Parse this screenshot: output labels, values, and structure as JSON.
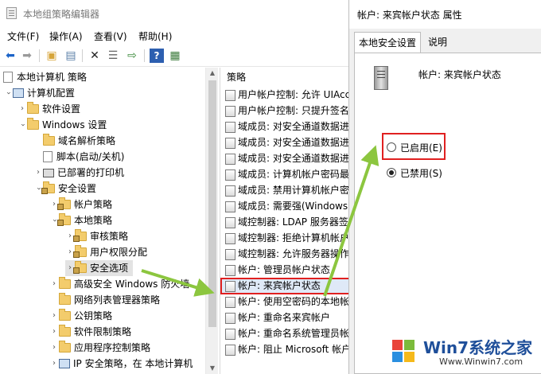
{
  "main_window": {
    "title": "本地组策略编辑器",
    "menu": [
      "文件(F)",
      "操作(A)",
      "查看(V)",
      "帮助(H)"
    ],
    "toolbar_icons": [
      "back-arrow-icon",
      "forward-arrow-icon",
      "up-folder-icon",
      "show-hide-tree-icon",
      "delete-icon",
      "properties-icon",
      "export-icon",
      "help-icon",
      "view-icon"
    ]
  },
  "tree": {
    "items": [
      {
        "label": "本地计算机 策略"
      },
      {
        "label": "计算机配置"
      },
      {
        "label": "软件设置"
      },
      {
        "label": "Windows 设置"
      },
      {
        "label": "域名解析策略"
      },
      {
        "label": "脚本(启动/关机)"
      },
      {
        "label": "已部署的打印机"
      },
      {
        "label": "安全设置"
      },
      {
        "label": "帐户策略"
      },
      {
        "label": "本地策略"
      },
      {
        "label": "审核策略"
      },
      {
        "label": "用户权限分配"
      },
      {
        "label": "安全选项"
      },
      {
        "label": "高级安全 Windows 防火墙"
      },
      {
        "label": "网络列表管理器策略"
      },
      {
        "label": "公钥策略"
      },
      {
        "label": "软件限制策略"
      },
      {
        "label": "应用程序控制策略"
      },
      {
        "label": "IP 安全策略，在 本地计算机"
      }
    ]
  },
  "policy_list": {
    "header": "策略",
    "items": [
      "用户帐户控制: 允许 UIAccess",
      "用户帐户控制: 只提升签名并",
      "域成员: 对安全通道数据进行",
      "域成员: 对安全通道数据进行",
      "域成员: 对安全通道数据进行",
      "域成员: 计算机帐户密码最",
      "域成员: 禁用计算机帐户密码",
      "域成员: 需要强(Windows",
      "域控制器: LDAP 服务器签名",
      "域控制器: 拒绝计算机帐户密",
      "域控制器: 允许服务器操作",
      "帐户: 管理员帐户状态",
      "帐户: 来宾帐户状态",
      "帐户: 使用空密码的本地帐",
      "帐户: 重命名来宾帐户",
      "帐户: 重命名系统管理员帐",
      "帐户: 阻止 Microsoft 帐户"
    ]
  },
  "dialog": {
    "title": "帐户: 来宾帐户状态 属性",
    "tabs": [
      "本地安全设置",
      "说明"
    ],
    "policy_name": "帐户: 来宾帐户状态",
    "option_enabled": "已启用(E)",
    "option_disabled": "已禁用(S)",
    "selected": "已禁用(S)"
  },
  "annotations": {
    "highlight_color": "#e02020",
    "arrow_color": "#8cc63f"
  },
  "watermark": {
    "brand": "Win7系统之家",
    "url": "Www.Winwin7.com"
  }
}
